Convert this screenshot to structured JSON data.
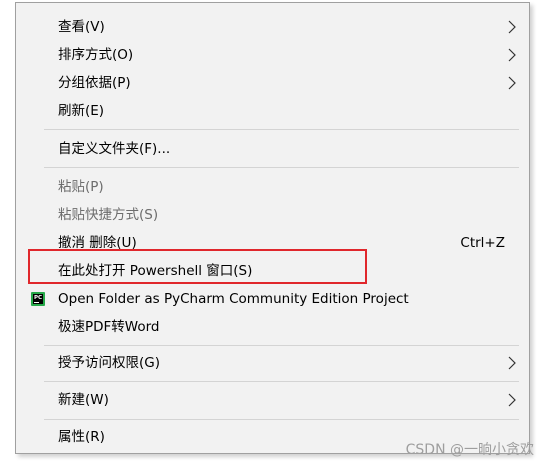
{
  "menu": {
    "items": [
      {
        "label": "查看(V)",
        "has_submenu": true
      },
      {
        "label": "排序方式(O)",
        "has_submenu": true
      },
      {
        "label": "分组依据(P)",
        "has_submenu": true
      },
      {
        "label": "刷新(E)"
      },
      {
        "label": "自定义文件夹(F)..."
      },
      {
        "label": "粘贴(P)",
        "disabled": true
      },
      {
        "label": "粘贴快捷方式(S)",
        "disabled": true
      },
      {
        "label": "撤消 删除(U)",
        "shortcut": "Ctrl+Z"
      },
      {
        "label": "在此处打开 Powershell 窗口(S)",
        "highlighted": true
      },
      {
        "label": "Open Folder as PyCharm Community Edition Project",
        "icon": "pycharm-icon"
      },
      {
        "label": "极速PDF转Word"
      },
      {
        "label": "授予访问权限(G)",
        "has_submenu": true
      },
      {
        "label": "新建(W)",
        "has_submenu": true
      },
      {
        "label": "属性(R)"
      }
    ],
    "pycharm_icon_text": "PC"
  },
  "annotation": {
    "highlight_color": "#e0272c"
  },
  "watermark": "CSDN @一晌小贪欢"
}
